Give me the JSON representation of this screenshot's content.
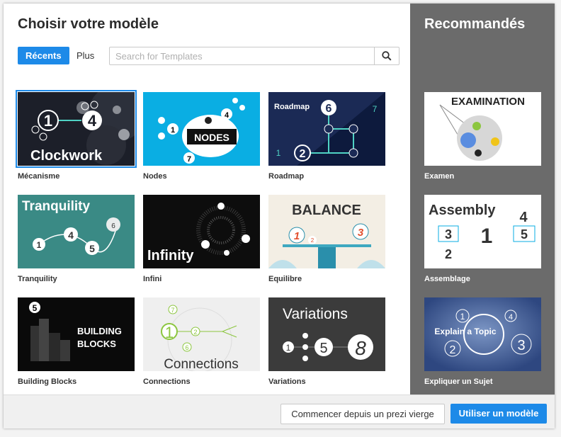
{
  "dialog": {
    "title": "Choisir votre modèle",
    "tabs": [
      {
        "label": "Récents",
        "active": true
      },
      {
        "label": "Plus",
        "active": false
      }
    ],
    "search": {
      "placeholder": "Search for Templates",
      "value": "",
      "icon": "search-icon"
    }
  },
  "templates": [
    {
      "label": "Mécanisme",
      "thumb_text": "Clockwork",
      "selected": true
    },
    {
      "label": "Nodes",
      "thumb_text": "NODES"
    },
    {
      "label": "Roadmap",
      "thumb_text": "Roadmap"
    },
    {
      "label": "Tranquility",
      "thumb_text": "Tranquility"
    },
    {
      "label": "Infini",
      "thumb_text": "Infinity"
    },
    {
      "label": "Equilibre",
      "thumb_text": "BALANCE"
    },
    {
      "label": "Building Blocks",
      "thumb_text": "BUILDING BLOCKS"
    },
    {
      "label": "Connections",
      "thumb_text": "Connections"
    },
    {
      "label": "Variations",
      "thumb_text": "Variations"
    }
  ],
  "recommended": {
    "title": "Recommandés",
    "items": [
      {
        "label": "Examen",
        "thumb_text": "EXAMINATION"
      },
      {
        "label": "Assemblage",
        "thumb_text": "Assembly"
      },
      {
        "label": "Expliquer un Sujet",
        "thumb_text": "Explain a Topic"
      }
    ]
  },
  "footer": {
    "secondary_label": "Commencer depuis un prezi vierge",
    "primary_label": "Utiliser un modèle"
  },
  "colors": {
    "accent": "#1d8ae8",
    "sidebar": "#6b6b6b"
  }
}
